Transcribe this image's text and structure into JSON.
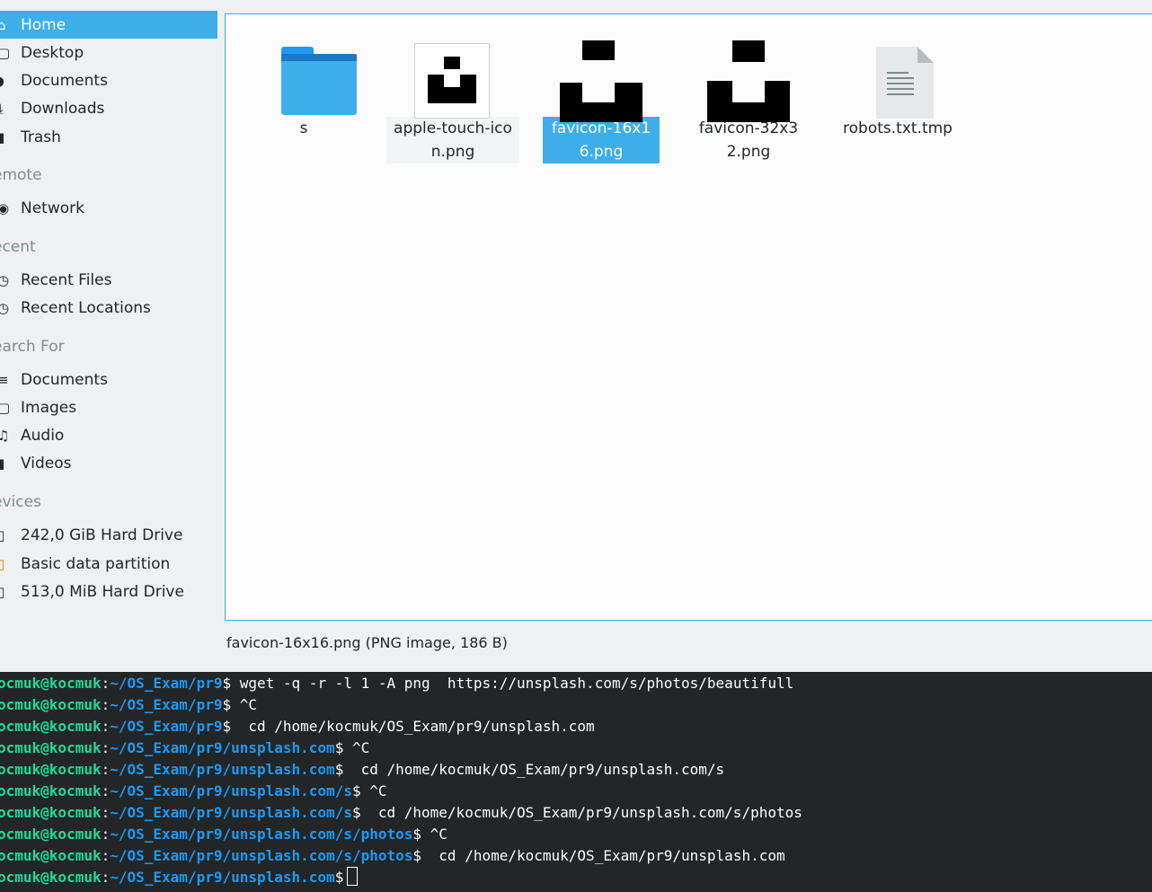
{
  "sidebar": {
    "places": [
      {
        "label": "Home",
        "icon": "home-icon",
        "glyph": "⌂",
        "active": true
      },
      {
        "label": "Desktop",
        "icon": "desktop-icon",
        "glyph": "▢"
      },
      {
        "label": "Documents",
        "icon": "documents-icon",
        "glyph": "◗"
      },
      {
        "label": "Downloads",
        "icon": "downloads-icon",
        "glyph": "⤓"
      },
      {
        "label": "Trash",
        "icon": "trash-icon",
        "glyph": "▮"
      }
    ],
    "remote_title": "emote",
    "remote": [
      {
        "label": "Network",
        "icon": "network-icon",
        "glyph": "◉"
      }
    ],
    "recent_title": "ecent",
    "recent": [
      {
        "label": "Recent Files",
        "icon": "recent-files-icon",
        "glyph": "◷"
      },
      {
        "label": "Recent Locations",
        "icon": "recent-locations-icon",
        "glyph": "◷"
      }
    ],
    "search_title": "earch For",
    "search": [
      {
        "label": "Documents",
        "icon": "search-documents-icon",
        "glyph": "≡"
      },
      {
        "label": "Images",
        "icon": "images-icon",
        "glyph": "▢"
      },
      {
        "label": "Audio",
        "icon": "audio-icon",
        "glyph": "♫"
      },
      {
        "label": "Videos",
        "icon": "videos-icon",
        "glyph": "▮"
      }
    ],
    "devices_title": "evices",
    "devices": [
      {
        "label": "242,0 GiB Hard Drive",
        "icon": "hard-drive-icon",
        "glyph": "▯"
      },
      {
        "label": "Basic data partition",
        "icon": "partition-icon",
        "glyph": "▯"
      },
      {
        "label": "513,0 MiB Hard Drive",
        "icon": "hard-drive-icon",
        "glyph": "▯"
      }
    ]
  },
  "files": [
    {
      "name": "s",
      "type": "folder",
      "icon": "folder-icon"
    },
    {
      "name": "apple-touch-icon.png",
      "type": "image",
      "icon": "image-thumbnail",
      "state": "hovered"
    },
    {
      "name": "favicon-16x16.png",
      "type": "image",
      "icon": "image-thumbnail",
      "state": "selected"
    },
    {
      "name": "favicon-32x32.png",
      "type": "image",
      "icon": "image-thumbnail"
    },
    {
      "name": "robots.txt.tmp",
      "type": "text",
      "icon": "text-file-icon"
    }
  ],
  "status": {
    "text": "favicon-16x16.png (PNG image, 186 B)"
  },
  "terminal": {
    "lines": [
      {
        "user": "ocmuk@kocmuk",
        "path": "~/OS_Exam/pr9",
        "cmd": " wget -q -r -l 1 -A png  https://unsplash.com/s/photos/beautifull"
      },
      {
        "user": "ocmuk@kocmuk",
        "path": "~/OS_Exam/pr9",
        "cmd": " ^C"
      },
      {
        "user": "ocmuk@kocmuk",
        "path": "~/OS_Exam/pr9",
        "cmd": "  cd /home/kocmuk/OS_Exam/pr9/unsplash.com"
      },
      {
        "user": "ocmuk@kocmuk",
        "path": "~/OS_Exam/pr9/unsplash.com",
        "cmd": " ^C"
      },
      {
        "user": "ocmuk@kocmuk",
        "path": "~/OS_Exam/pr9/unsplash.com",
        "cmd": "  cd /home/kocmuk/OS_Exam/pr9/unsplash.com/s"
      },
      {
        "user": "ocmuk@kocmuk",
        "path": "~/OS_Exam/pr9/unsplash.com/s",
        "cmd": " ^C"
      },
      {
        "user": "ocmuk@kocmuk",
        "path": "~/OS_Exam/pr9/unsplash.com/s",
        "cmd": "  cd /home/kocmuk/OS_Exam/pr9/unsplash.com/s/photos"
      },
      {
        "user": "ocmuk@kocmuk",
        "path": "~/OS_Exam/pr9/unsplash.com/s/photos",
        "cmd": " ^C"
      },
      {
        "user": "ocmuk@kocmuk",
        "path": "~/OS_Exam/pr9/unsplash.com/s/photos",
        "cmd": "  cd /home/kocmuk/OS_Exam/pr9/unsplash.com"
      },
      {
        "user": "ocmuk@kocmuk",
        "path": "~/OS_Exam/pr9/unsplash.com",
        "cmd": " ",
        "cursor": true
      }
    ]
  },
  "colors": {
    "accent": "#3daee9",
    "terminal_bg": "#232627",
    "terminal_user": "#1cdc9a",
    "terminal_path": "#1d99f3"
  }
}
